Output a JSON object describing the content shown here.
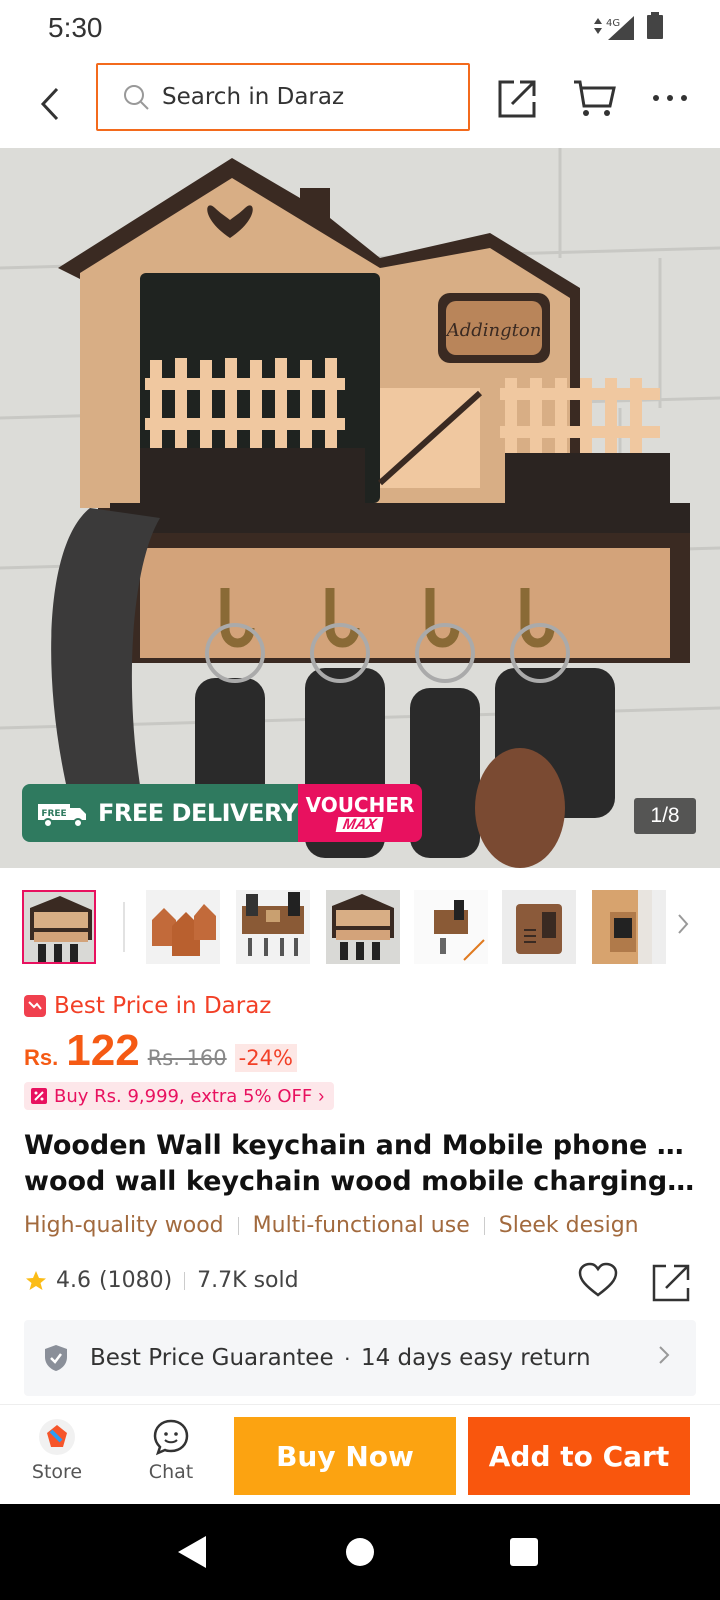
{
  "status_bar": {
    "time": "5:30",
    "network": "4G"
  },
  "header": {
    "search_placeholder": "Search in Daraz"
  },
  "hero": {
    "delivery_label": "FREE DELIVERY",
    "delivery_tag": "FREE",
    "voucher_line1": "VOUCHER",
    "voucher_line2": "MAX",
    "sign_text": "Addington",
    "counter": "1/8"
  },
  "price": {
    "best_price_label": "Best Price in Daraz",
    "currency": "Rs.",
    "current": "122",
    "original": "Rs. 160",
    "discount": "-24%",
    "promo": "Buy Rs. 9,999, extra 5% OFF"
  },
  "product": {
    "title_line1": "Wooden Wall keychain and Mobile phone holder",
    "title_line2": "wood wall keychain wood mobile charging hol...",
    "features": [
      "High-quality wood",
      "Multi-functional use",
      "Sleek design"
    ],
    "rating": "4.6",
    "reviews": "(1080)",
    "sold": "7.7K sold"
  },
  "guarantee": {
    "item1": "Best Price Guarantee",
    "separator": "·",
    "item2": "14 days easy return"
  },
  "actions": {
    "store": "Store",
    "chat": "Chat",
    "buy_now": "Buy Now",
    "add_to_cart": "Add to Cart"
  },
  "colors": {
    "accent": "#f55a14",
    "buy_now": "#fca311",
    "add_to_cart": "#f9560d",
    "voucher": "#e8115f",
    "delivery": "#2f7a5f"
  }
}
